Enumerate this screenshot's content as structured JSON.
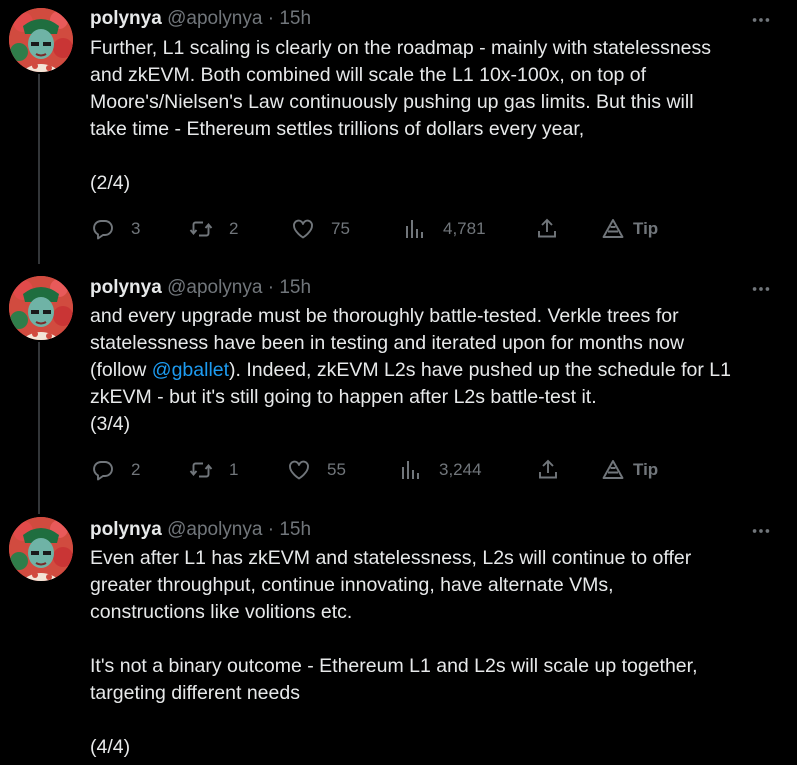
{
  "tweets": [
    {
      "name": "polynya",
      "handle": "@apolynya",
      "sep": "·",
      "time": "15h",
      "lines": [
        "Further, L1 scaling is clearly on the roadmap - mainly with statelessness",
        "and zkEVM. Both combined will scale the L1 10x-100x, on top of",
        "Moore's/Nielsen's Law continuously pushing up gas limits. But this will",
        "take time - Ethereum settles trillions of dollars every year,",
        "",
        "(2/4)"
      ],
      "replies": "3",
      "reposts": "2",
      "likes": "75",
      "views": "4,781",
      "tip": "Tip"
    },
    {
      "name": "polynya",
      "handle": "@apolynya",
      "sep": "·",
      "time": "15h",
      "lines": [
        "and every upgrade must be thoroughly battle-tested. Verkle trees for",
        "statelessness have been in testing and iterated upon for months now"
      ],
      "line3_pre": "(follow ",
      "mention": "@gballet",
      "line3_post": "). Indeed, zkEVM L2s have pushed up the schedule for L1",
      "lines_after": [
        "zkEVM - but it's still going to happen after L2s battle-test it.",
        "(3/4)"
      ],
      "replies": "2",
      "reposts": "1",
      "likes": "55",
      "views": "3,244",
      "tip": "Tip"
    },
    {
      "name": "polynya",
      "handle": "@apolynya",
      "sep": "·",
      "time": "15h",
      "lines": [
        "Even after L1 has zkEVM and statelessness, L2s will continue to offer",
        "greater throughput, continue innovating, have alternate VMs,",
        "constructions like volitions etc.",
        "",
        "It's not a binary outcome - Ethereum L1 and L2s will scale up together,",
        "targeting different needs",
        "",
        "(4/4)"
      ]
    }
  ],
  "icons": [
    "reply-icon",
    "repost-icon",
    "like-icon",
    "views-icon",
    "share-icon",
    "tip-icon",
    "more-icon"
  ],
  "colors": {
    "background": "#000000",
    "text": "#e7e9ea",
    "muted": "#71767b",
    "link": "#1d9bf0",
    "thread_line": "#333639"
  }
}
